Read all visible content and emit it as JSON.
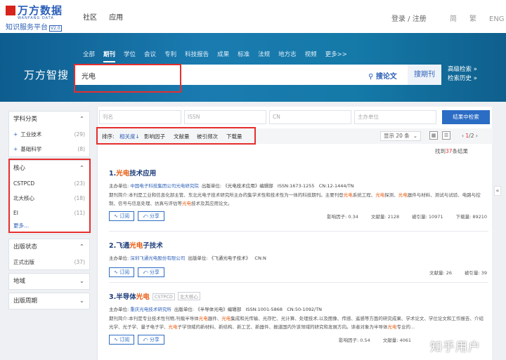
{
  "header": {
    "logo_text": "万方数据",
    "logo_sub": "WANFANG DATA",
    "logo_tag": "知识服务平台",
    "logo_version": "V2.0",
    "nav": [
      "社区",
      "应用"
    ],
    "login": "登录 / 注册",
    "langs": [
      "简",
      "繁",
      "ENG"
    ]
  },
  "categories": [
    "全部",
    "期刊",
    "学位",
    "会议",
    "专利",
    "科技报告",
    "成果",
    "标准",
    "法规",
    "地方志",
    "视频",
    "更多>>"
  ],
  "active_category": "期刊",
  "brand": "万方智搜",
  "search": {
    "query": "光电",
    "paper_btn": "搜论文",
    "journal_btn": "搜期刊",
    "advanced": "高级检索",
    "history": "检索历史"
  },
  "sidebar": {
    "subject": {
      "title": "学科分类",
      "items": [
        {
          "label": "工业技术",
          "count": "(29)"
        },
        {
          "label": "基础科学",
          "count": "(8)"
        }
      ]
    },
    "core": {
      "title": "核心",
      "items": [
        {
          "label": "CSTPCD",
          "count": "(23)"
        },
        {
          "label": "北大核心",
          "count": "(18)"
        },
        {
          "label": "EI",
          "count": "(11)"
        }
      ],
      "more": "更多..."
    },
    "status": {
      "title": "出版状态",
      "items": [
        {
          "label": "正式出版",
          "count": "(37)"
        }
      ]
    },
    "region": {
      "title": "地域"
    },
    "cycle": {
      "title": "出版周期"
    }
  },
  "filters": {
    "journal_name": "刊名",
    "issn": "ISSN",
    "cn": "CN",
    "sponsor": "主办单位",
    "submit": "结果中检索"
  },
  "sort": {
    "label": "排序:",
    "options": [
      "相关度",
      "影响因子",
      "文献量",
      "被引频次",
      "下载量"
    ],
    "active": "相关度",
    "page_size": "显示 20 条",
    "page": "1",
    "total_pages": "2"
  },
  "found": {
    "prefix": "找到",
    "count": "37",
    "suffix": "条结果"
  },
  "results": [
    {
      "num": "1.",
      "title_hl": "光电",
      "title_rest": "技术应用",
      "meta_org_label": "主办单位:",
      "meta_org": "中国电子科技集团公司光电研究院",
      "meta_pub_label": "出版单位:",
      "meta_pub": "《光电技术应用》编辑部",
      "issn": "ISSN:1673-1255",
      "cn": "CN:12-1444/TN",
      "desc_a": "期刊简介:本刊是工业和信息化部主管、东北光电子技术研究所主办的集学术性和技术性为一体的科技期刊。主要刊登",
      "desc_hl1": "光电",
      "desc_b": "系统工程、",
      "desc_hl2": "光电",
      "desc_c": "探测、",
      "desc_hl3": "光电",
      "desc_d": "器件与材料、测试与试验、电路与控制、信号与信息处理、仿真与评估等",
      "desc_hl4": "光电",
      "desc_e": "技术及其应用论文。",
      "sub": "订阅",
      "share": "分享",
      "impact": "影响因子: 0.34",
      "docs": "文献量: 2128",
      "cites": "被引量: 10971",
      "downloads": "下载量: 89210"
    },
    {
      "num": "2.",
      "title_a": "飞通",
      "title_hl": "光电",
      "title_rest": "子技术",
      "meta_org_label": "主办单位:",
      "meta_org": "深圳飞通光电股份有限公司",
      "meta_pub_label": "出版单位:",
      "meta_pub": "《飞通光电子技术》",
      "cn": "CN:N",
      "sub": "订阅",
      "share": "分享",
      "docs": "文献量: 26",
      "cites": "被引量: 39"
    },
    {
      "num": "3.",
      "title_a": "半导体",
      "title_hl": "光电",
      "tags": [
        "CSTPCD",
        "北大核心"
      ],
      "meta_org_label": "主办单位:",
      "meta_org": "重庆光电技术研究所",
      "meta_pub_label": "出版单位:",
      "meta_pub": "《半导体光电》编辑部",
      "issn": "ISSN:1001-5868",
      "cn": "CN:50-1092/TN",
      "desc_a": "期刊简介:本刊是专业技术性刊物,刊载半导体",
      "desc_hl1": "光电",
      "desc_b": "器件、",
      "desc_hl2": "光电",
      "desc_c": "集成和光传输、光存贮、光计算、处理技术,以及图像、传感、遥感等方面的研究成果、学术论文、学位论文和工作报告、介绍光学、光子学、量子电子学、",
      "desc_hl3": "光电",
      "desc_d": "子学领域的新材料、新结构、新工艺、新器件、报道国内外该领域的研究和发展方向。读者对象为半导体",
      "desc_hl4": "光电",
      "desc_e": "专业的...",
      "sub": "订阅",
      "share": "分享",
      "impact": "影响因子: 0.54",
      "docs": "文献量: 4061"
    }
  ],
  "watermark": "知乎用户",
  "colors": {
    "brand_blue": "#2b5fb7",
    "highlight": "#e8590c",
    "annotation_red": "#e62e2e",
    "banner": "#1a7bb0"
  }
}
